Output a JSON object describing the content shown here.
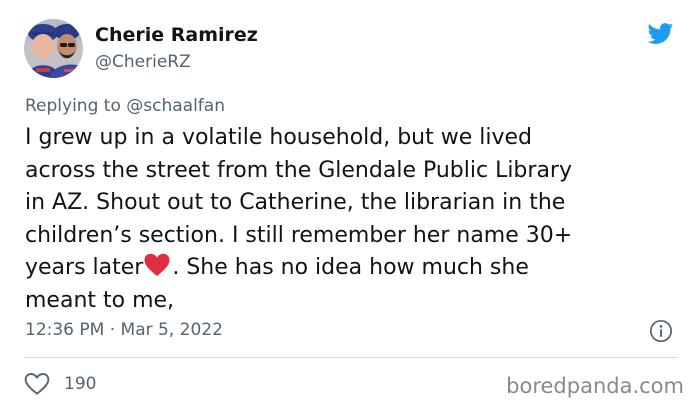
{
  "tweet": {
    "author": {
      "display_name": "Cherie Ramirez",
      "handle": "@CherieRZ"
    },
    "replying_to_prefix": "Replying to",
    "replying_to_handle": "@schaalfan",
    "text_lines": [
      "I grew up in a volatile household, but we lived",
      "across the street from the Glendale Public Library",
      "in AZ. Shout out to Catherine, the librarian in the",
      "children’s section. I still remember her name 30+",
      "years later",
      ". She has no idea how much she",
      "meant to me,"
    ],
    "emoji": "red-heart-emoji",
    "timestamp": "12:36 PM · Mar 5, 2022",
    "like_count": "190",
    "icons": {
      "brand": "twitter-bird-icon",
      "info": "info-icon",
      "like": "heart-outline-icon"
    },
    "colors": {
      "brand_blue": "#1d9bf0",
      "text": "#0f1419",
      "secondary_text": "#536471",
      "heart_red": "#e0245e",
      "divider": "#cfd9de"
    }
  },
  "watermark": {
    "text": "boredpanda.com"
  }
}
